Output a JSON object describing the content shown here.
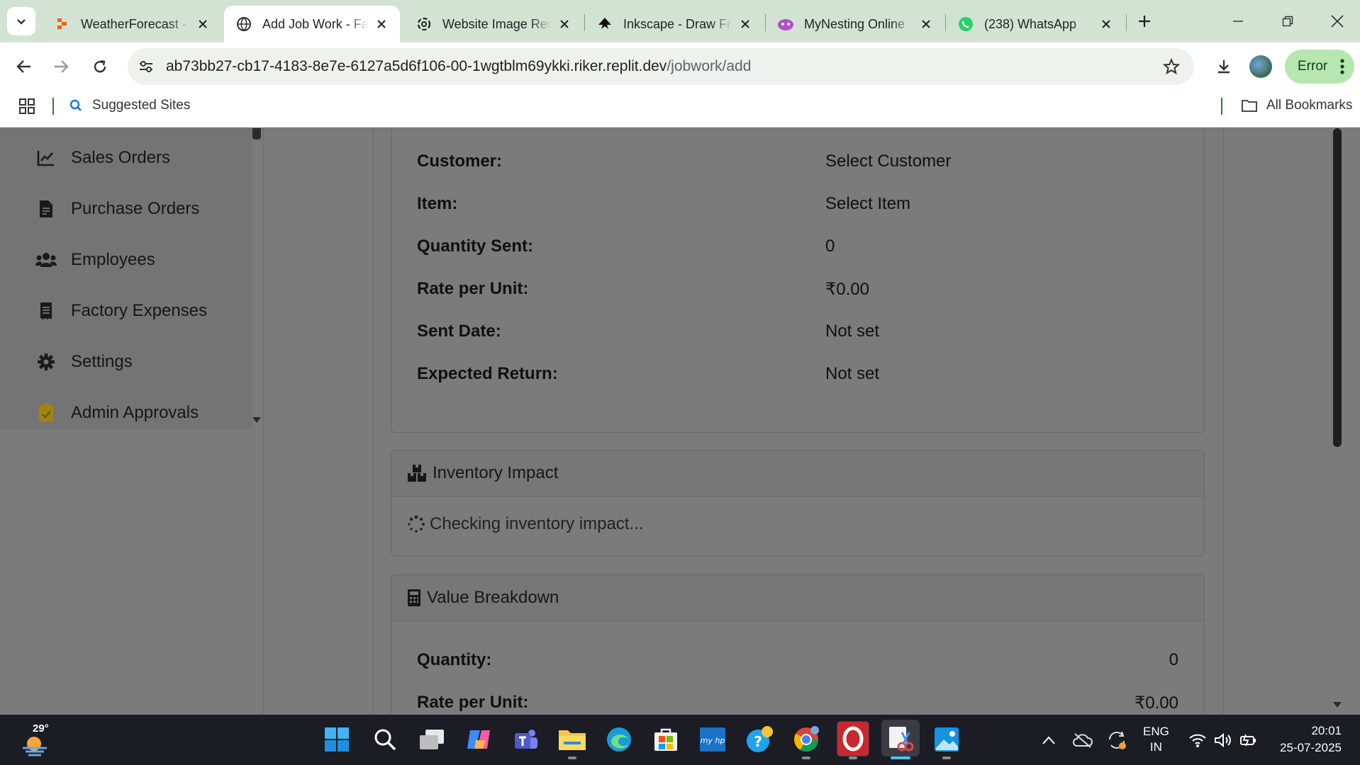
{
  "browser": {
    "tabs": [
      {
        "title": "WeatherForecast -",
        "active": false
      },
      {
        "title": "Add Job Work - Fa",
        "active": true
      },
      {
        "title": "Website Image Rec",
        "active": false
      },
      {
        "title": "Inkscape - Draw Fr",
        "active": false
      },
      {
        "title": "MyNesting Online",
        "active": false
      },
      {
        "title": "(238) WhatsApp",
        "active": false
      }
    ],
    "url_host": "ab73bb27-cb17-4183-8e7e-6127a5d6f106-00-1wgtblm69ykki.riker.replit.dev",
    "url_path": "/jobwork/add",
    "profile_status": "Error",
    "bookmarks": {
      "suggested": "Suggested Sites",
      "all": "All Bookmarks"
    }
  },
  "sidebar": {
    "items": [
      {
        "label": "Sales Orders",
        "icon": "chart-line-icon"
      },
      {
        "label": "Purchase Orders",
        "icon": "file-invoice-icon"
      },
      {
        "label": "Employees",
        "icon": "users-icon"
      },
      {
        "label": "Factory Expenses",
        "icon": "receipt-icon"
      },
      {
        "label": "Settings",
        "icon": "gear-icon"
      },
      {
        "label": "Admin Approvals",
        "icon": "clipboard-check-icon"
      }
    ]
  },
  "summary": {
    "rows": [
      {
        "label": "Customer:",
        "value": "Select Customer"
      },
      {
        "label": "Item:",
        "value": "Select Item"
      },
      {
        "label": "Quantity Sent:",
        "value": "0"
      },
      {
        "label": "Rate per Unit:",
        "value": "₹0.00"
      },
      {
        "label": "Sent Date:",
        "value": "Not set"
      },
      {
        "label": "Expected Return:",
        "value": "Not set"
      }
    ]
  },
  "inventory": {
    "title": "Inventory Impact",
    "status": "Checking inventory impact..."
  },
  "value_breakdown": {
    "title": "Value Breakdown",
    "rows": [
      {
        "label": "Quantity:",
        "value": "0"
      },
      {
        "label": "Rate per Unit:",
        "value": "₹0.00"
      }
    ]
  },
  "taskbar": {
    "temperature": "29°",
    "language": "ENG",
    "region": "IN",
    "time": "20:01",
    "date": "25-07-2025"
  },
  "colors": {
    "tabstrip": "#d3e3d3",
    "overlay_page": "#7b7b7b",
    "taskbar": "#1b1c24",
    "error_pill": "#b6e7b0"
  }
}
